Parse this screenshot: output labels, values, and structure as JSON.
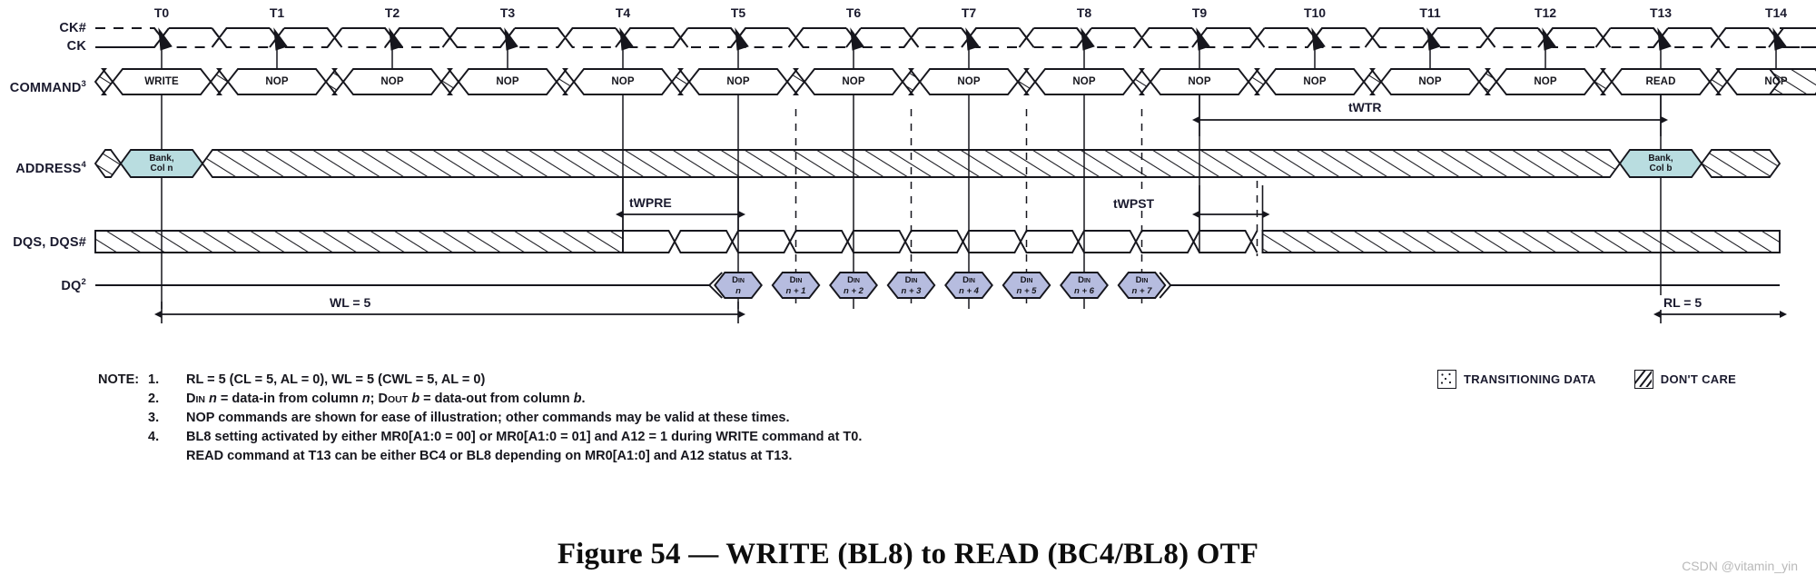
{
  "figure": {
    "title": "Figure 54 — WRITE (BL8) to READ (BC4/BL8) OTF",
    "watermark": "CSDN @vitamin_yin"
  },
  "signals": {
    "ck_hash": "CK#",
    "ck": "CK",
    "command": "COMMAND",
    "command_note": "3",
    "address": "ADDRESS",
    "address_note": "4",
    "dqs": "DQS, DQS#",
    "dq": "DQ",
    "dq_note": "2"
  },
  "clock_ticks": [
    "T0",
    "T1",
    "T2",
    "T3",
    "T4",
    "T5",
    "T6",
    "T7",
    "T8",
    "T9",
    "T10",
    "T11",
    "T12",
    "T13",
    "T14"
  ],
  "commands": [
    {
      "tick": "T0",
      "label": "WRITE"
    },
    {
      "tick": "T1",
      "label": "NOP"
    },
    {
      "tick": "T2",
      "label": "NOP"
    },
    {
      "tick": "T3",
      "label": "NOP"
    },
    {
      "tick": "T4",
      "label": "NOP"
    },
    {
      "tick": "T5",
      "label": "NOP"
    },
    {
      "tick": "T6",
      "label": "NOP"
    },
    {
      "tick": "T7",
      "label": "NOP"
    },
    {
      "tick": "T8",
      "label": "NOP"
    },
    {
      "tick": "T9",
      "label": "NOP"
    },
    {
      "tick": "T10",
      "label": "NOP"
    },
    {
      "tick": "T11",
      "label": "NOP"
    },
    {
      "tick": "T12",
      "label": "NOP"
    },
    {
      "tick": "T13",
      "label": "READ"
    },
    {
      "tick": "T14",
      "label": "NOP"
    }
  ],
  "address_cells": [
    {
      "tick": "T0",
      "line1": "Bank,",
      "line2": "Col n"
    },
    {
      "tick": "T13",
      "line1": "Bank,",
      "line2": "Col b"
    }
  ],
  "dq_burst": [
    {
      "top": "DIN",
      "bottom": "n"
    },
    {
      "top": "DIN",
      "bottom": "n + 1"
    },
    {
      "top": "DIN",
      "bottom": "n + 2"
    },
    {
      "top": "DIN",
      "bottom": "n + 3"
    },
    {
      "top": "DIN",
      "bottom": "n + 4"
    },
    {
      "top": "DIN",
      "bottom": "n + 5"
    },
    {
      "top": "DIN",
      "bottom": "n + 6"
    },
    {
      "top": "DIN",
      "bottom": "n + 7"
    }
  ],
  "timings": {
    "twtr": "tWTR",
    "twpre": "tWPRE",
    "twpst": "tWPST",
    "wl": "WL = 5",
    "rl": "RL = 5"
  },
  "notes": {
    "header": "NOTE:",
    "items": [
      {
        "num": "1.",
        "text": "RL = 5 (CL = 5, AL = 0), WL = 5 (CWL = 5, AL = 0)"
      },
      {
        "num": "2.",
        "text": "DIN n  = data-in from column n; DOUT b  = data-out from column b."
      },
      {
        "num": "3.",
        "text": "NOP commands are shown for ease of illustration; other commands may be valid at these times."
      },
      {
        "num": "4.",
        "text": "BL8 setting activated by either MR0[A1:0 = 00] or MR0[A1:0 = 01] and A12 = 1 during WRITE command at T0."
      },
      {
        "num": "",
        "text": "READ command at T13 can be either BC4 or BL8 depending on MR0[A1:0] and A12 status at T13."
      }
    ]
  },
  "legend": [
    {
      "name": "transitioning-data",
      "label": "TRANSITIONING DATA"
    },
    {
      "name": "dont-care",
      "label": "DON'T CARE"
    }
  ],
  "colors": {
    "line": "#16161d",
    "address_fill": "#b9dde0",
    "dq_fill": "#b6bcdf",
    "text": "#1a1a2e",
    "watermark": "#b9b9b9"
  }
}
